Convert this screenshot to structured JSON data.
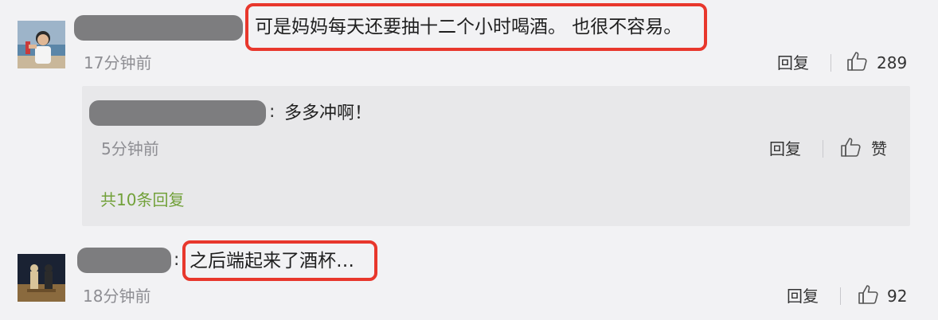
{
  "comments": [
    {
      "text": "可是妈妈每天还要抽十二个小时喝酒。 也很不容易。",
      "time": "17分钟前",
      "reply_label": "回复",
      "likes": "289"
    },
    {
      "text": "之后端起来了酒杯…",
      "time": "18分钟前",
      "reply_label": "回复",
      "likes": "92"
    }
  ],
  "nested_reply": {
    "text": "多多冲啊！",
    "time": "5分钟前",
    "reply_label": "回复",
    "like_label": "赞",
    "more_replies": "共10条回复"
  },
  "colors": {
    "background": "#f2f2f4",
    "reply_panel": "#e8e8ea",
    "highlight": "#e8372c",
    "link_green": "#72a13a",
    "muted": "#8e8e93"
  },
  "icons": {
    "like": "thumbs-up-icon"
  }
}
